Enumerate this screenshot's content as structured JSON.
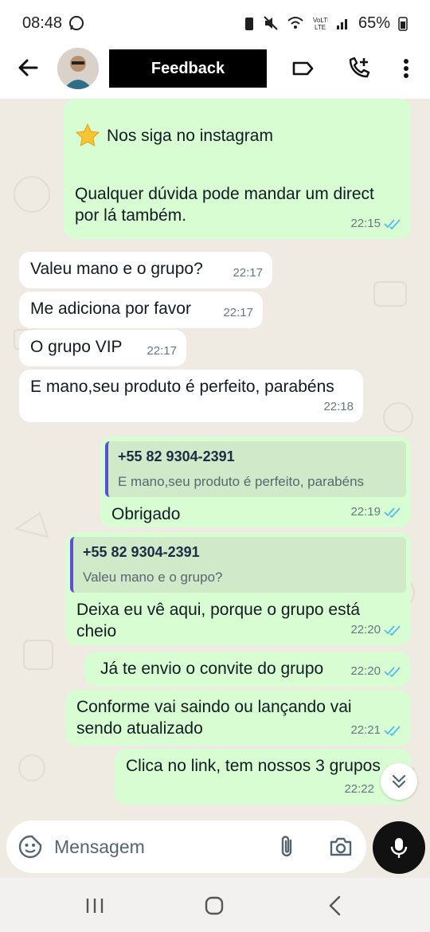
{
  "status_bar": {
    "time": "08:48",
    "battery": "65%"
  },
  "header": {
    "title": "Feedback"
  },
  "messages": [
    {
      "dir": "out",
      "line1": "Nos siga no instagram",
      "line2": "Qualquer dúvida pode mandar um direct",
      "line3": "por lá também.",
      "time": "22:15"
    },
    {
      "dir": "in",
      "text": "Valeu mano e o grupo?",
      "time": "22:17"
    },
    {
      "dir": "in",
      "text": "Me adiciona por favor",
      "time": "22:17"
    },
    {
      "dir": "in",
      "text": "O grupo VIP",
      "time": "22:17"
    },
    {
      "dir": "in",
      "text": "E mano,seu produto é perfeito, parabéns",
      "time": "22:18"
    },
    {
      "dir": "out",
      "quote_name": "+55 82 9304-2391",
      "quote_text": "E mano,seu produto é perfeito, parabéns",
      "text": "Obrigado",
      "time": "22:19"
    },
    {
      "dir": "out",
      "quote_name": "+55 82 9304-2391",
      "quote_text": "Valeu mano e o grupo?",
      "line1": "Deixa eu vê aqui, porque o grupo está",
      "line2": "cheio",
      "time": "22:20"
    },
    {
      "dir": "out",
      "text": "Já te envio o convite do grupo",
      "time": "22:20"
    },
    {
      "dir": "out",
      "line1": "Conforme vai saindo ou lançando vai",
      "line2": "sendo atualizado",
      "time": "22:21"
    },
    {
      "dir": "out",
      "text": "Clica no link, tem nossos 3 grupos",
      "time": "22:22"
    }
  ],
  "composer": {
    "placeholder": "Mensagem"
  },
  "colors": {
    "outgoing": "#d9fdd3",
    "incoming": "#ffffff",
    "read_ticks": "#53bdeb",
    "background": "#efeae2"
  },
  "icons": [
    "whatsapp-icon",
    "back-arrow-icon",
    "label-icon",
    "add-call-icon",
    "more-vert-icon",
    "star-emoji-icon",
    "double-check-icon",
    "scroll-down-icon",
    "sticker-icon",
    "attach-icon",
    "camera-icon",
    "mic-icon",
    "recents-icon",
    "home-icon",
    "back-nav-icon"
  ]
}
